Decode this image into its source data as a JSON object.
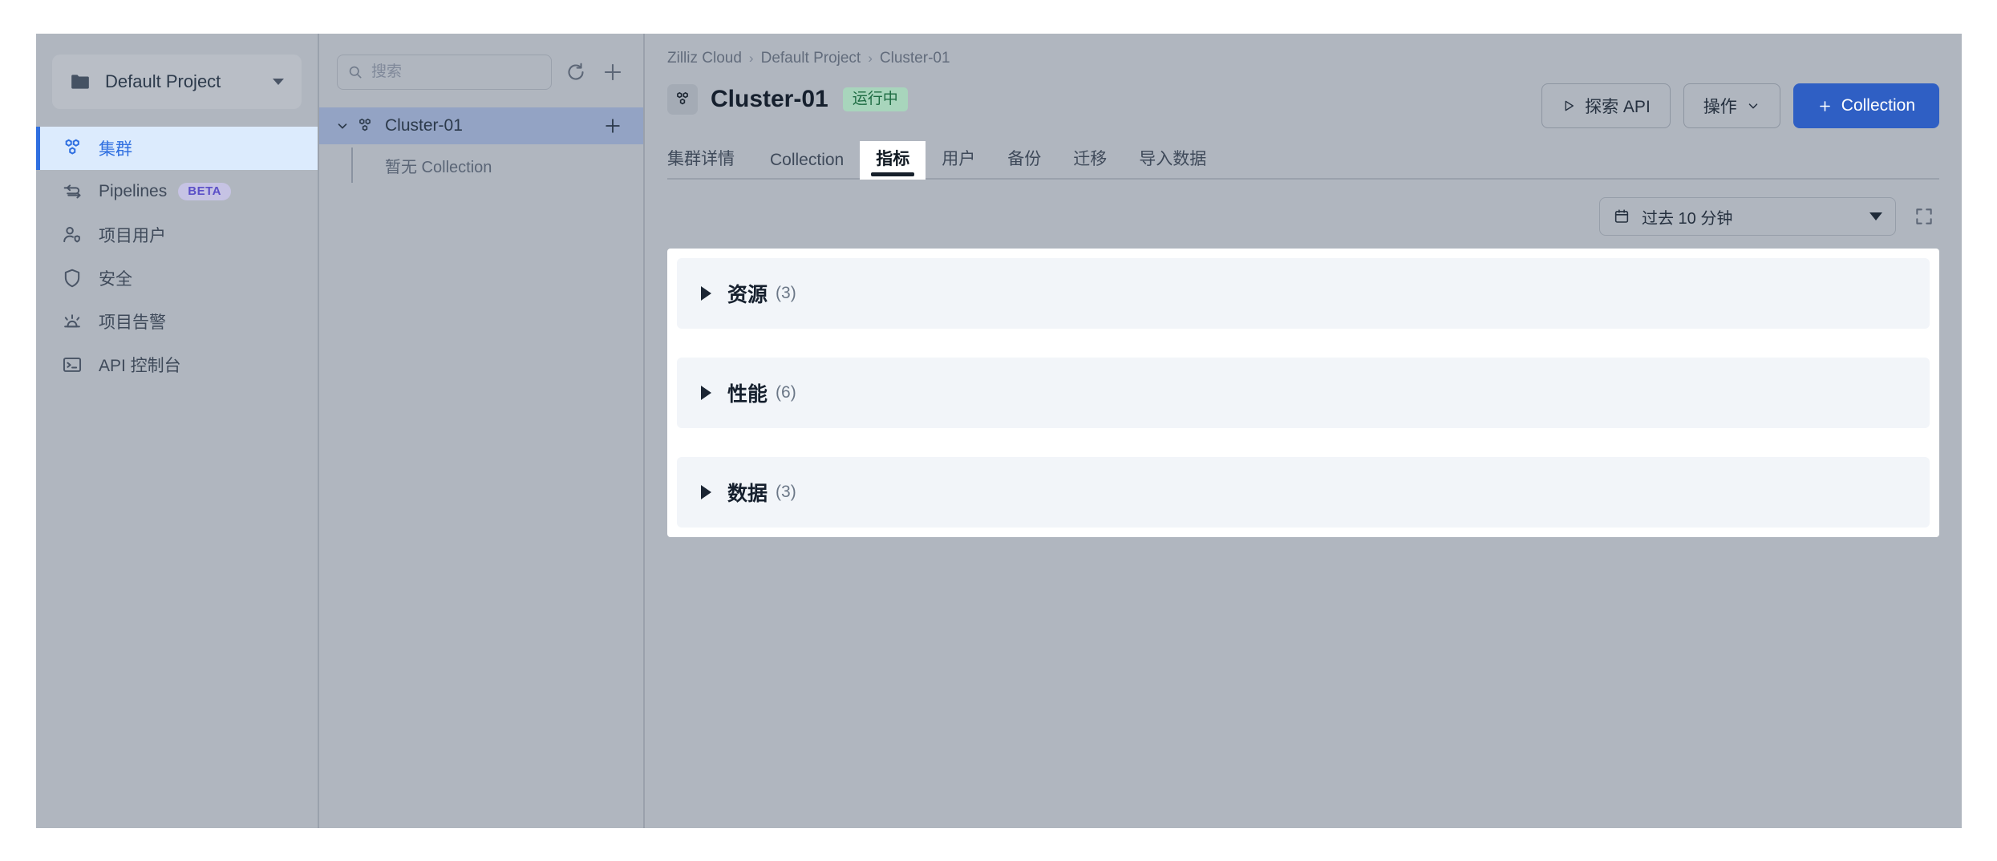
{
  "sidebar": {
    "project_switcher": {
      "icon": "folder-icon",
      "label": "Default Project",
      "caret": "chevron-down-icon"
    },
    "items": [
      {
        "icon": "cluster-icon",
        "label": "集群",
        "active": true,
        "badge": null
      },
      {
        "icon": "pipelines-icon",
        "label": "Pipelines",
        "active": false,
        "badge": "BETA"
      },
      {
        "icon": "project-user-icon",
        "label": "项目用户",
        "active": false,
        "badge": null
      },
      {
        "icon": "shield-icon",
        "label": "安全",
        "active": false,
        "badge": null
      },
      {
        "icon": "alert-icon",
        "label": "项目告警",
        "active": false,
        "badge": null
      },
      {
        "icon": "terminal-icon",
        "label": "API 控制台",
        "active": false,
        "badge": null
      }
    ]
  },
  "tree_panel": {
    "search": {
      "placeholder": "搜索",
      "value": "",
      "icon": "search-icon"
    },
    "refresh_icon": "refresh-icon",
    "add_icon": "plus-icon",
    "cluster": {
      "name": "Cluster-01",
      "expanded": true,
      "chevron": "chevron-down-icon",
      "icon": "cluster-icon",
      "add_icon": "plus-icon",
      "empty_label": "暂无 Collection"
    }
  },
  "header": {
    "breadcrumb": [
      "Zilliz Cloud",
      "Default Project",
      "Cluster-01"
    ],
    "breadcrumb_separator": "›",
    "title": "Cluster-01",
    "title_icon": "cluster-icon",
    "status": "运行中",
    "actions": {
      "explore_api": {
        "label": "探索 API",
        "icon": "play-icon"
      },
      "operations": {
        "label": "操作",
        "icon": "chevron-down-icon"
      },
      "add_collection": {
        "label": "Collection",
        "icon": "plus-icon"
      }
    }
  },
  "tabs": [
    {
      "label": "集群详情",
      "active": false
    },
    {
      "label": "Collection",
      "active": false
    },
    {
      "label": "指标",
      "active": true
    },
    {
      "label": "用户",
      "active": false
    },
    {
      "label": "备份",
      "active": false
    },
    {
      "label": "迁移",
      "active": false
    },
    {
      "label": "导入数据",
      "active": false
    }
  ],
  "toolbar": {
    "time_range": {
      "label": "过去 10 分钟",
      "icon": "calendar-icon",
      "caret": "chevron-down-icon"
    },
    "fullscreen_icon": "fullscreen-icon"
  },
  "metrics_sections": [
    {
      "title": "资源",
      "count": "(3)",
      "expanded": false
    },
    {
      "title": "性能",
      "count": "(6)",
      "expanded": false
    },
    {
      "title": "数据",
      "count": "(3)",
      "expanded": false
    }
  ],
  "colors": {
    "accent": "#2f6fe0",
    "primary_button": "#2f5fc4",
    "status_bg": "#a8d5bc",
    "status_text": "#1d6b42",
    "beta_bg": "#c6c3e4",
    "beta_text": "#5b4fc7",
    "app_bg": "#b0b6bf",
    "card_bg": "#ffffff",
    "accordion_bg": "#f2f5f9"
  }
}
